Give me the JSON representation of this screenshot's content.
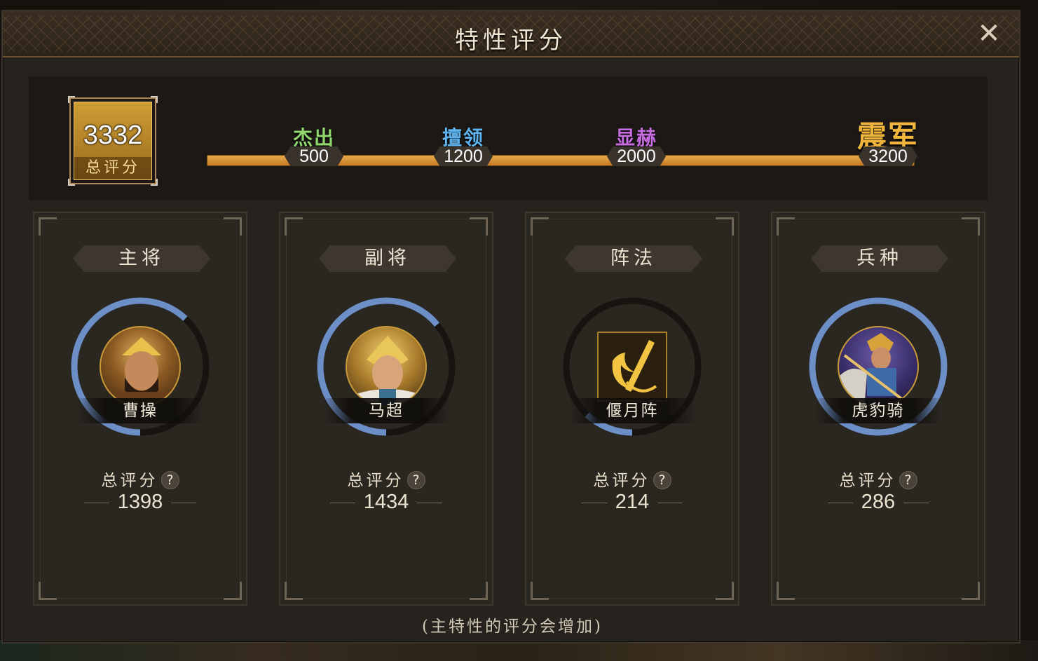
{
  "window": {
    "title": "特性评分",
    "close_icon": "close-x-icon"
  },
  "summary": {
    "total_score": "3332",
    "total_label": "总评分",
    "tiers": [
      {
        "name": "杰出",
        "threshold": "500",
        "color": "#8fd66c"
      },
      {
        "name": "擅领",
        "threshold": "1200",
        "color": "#5fb3ee"
      },
      {
        "name": "显赫",
        "threshold": "2000",
        "color": "#c86ddf"
      },
      {
        "name": "震军",
        "threshold": "3200",
        "color": "#f0b53c"
      }
    ]
  },
  "cards": [
    {
      "title": "主将",
      "name": "曹操",
      "score_label": "总评分",
      "score": "1398",
      "ring_fill": 0.62,
      "kind": "general"
    },
    {
      "title": "副将",
      "name": "马超",
      "score_label": "总评分",
      "score": "1434",
      "ring_fill": 0.64,
      "kind": "general"
    },
    {
      "title": "阵法",
      "name": "偃月阵",
      "score_label": "总评分",
      "score": "214",
      "ring_fill": 0.12,
      "kind": "formation"
    },
    {
      "title": "兵种",
      "name": "虎豹骑",
      "score_label": "总评分",
      "score": "286",
      "ring_fill": 1.0,
      "kind": "troop"
    }
  ],
  "help_icon": "question-mark-icon",
  "footer_note": "(主特性的评分会增加)",
  "colors": {
    "ring": "#6d8fc8",
    "ring_track": "#17140f",
    "gold": "#cf9d35"
  }
}
